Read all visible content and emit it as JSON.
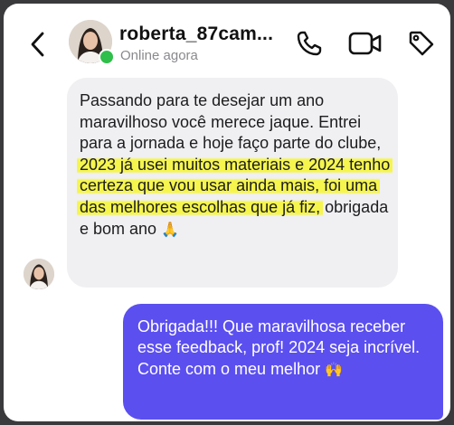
{
  "header": {
    "username": "roberta_87cam...",
    "status": "Online agora"
  },
  "icons": {
    "back": "chevron-left-icon",
    "call": "phone-icon",
    "video": "video-camera-icon",
    "tag": "tag-icon"
  },
  "messages": {
    "incoming": {
      "before_highlight": "Passando para te desejar um ano maravilhoso você merece jaque. Entrei para a jornada e hoje faço parte do clube, ",
      "highlight": "2023 já usei muitos materiais e 2024 tenho certeza que vou usar ainda mais, foi uma das melhores escolhas que já fiz,",
      "after_highlight": " obrigada e bom ano",
      "emoji": "🙏"
    },
    "outgoing": {
      "text": "Obrigada!!! Que maravilhosa receber esse feedback, prof! 2024 seja incrível. Conte com o meu melhor",
      "emoji": "🙌"
    }
  },
  "colors": {
    "outgoing_bubble": "#5b4ff0",
    "incoming_bubble": "#f0f0f2",
    "highlight": "#f6f637",
    "online": "#2fbf4a"
  }
}
